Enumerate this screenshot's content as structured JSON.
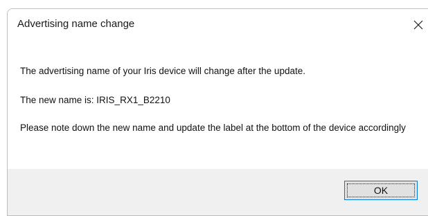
{
  "dialog": {
    "title": "Advertising name change",
    "close_icon": "close-icon",
    "message": {
      "line1": "The advertising name of your Iris device will change after the update.",
      "line2": "The new name is: IRIS_RX1_B2210",
      "line3": "Please note down the new name and update the label at the bottom of the device accordingly"
    },
    "ok_label": "OK"
  },
  "colors": {
    "footer_bg": "#f0f0f0",
    "button_border_focus": "#0078d7"
  }
}
